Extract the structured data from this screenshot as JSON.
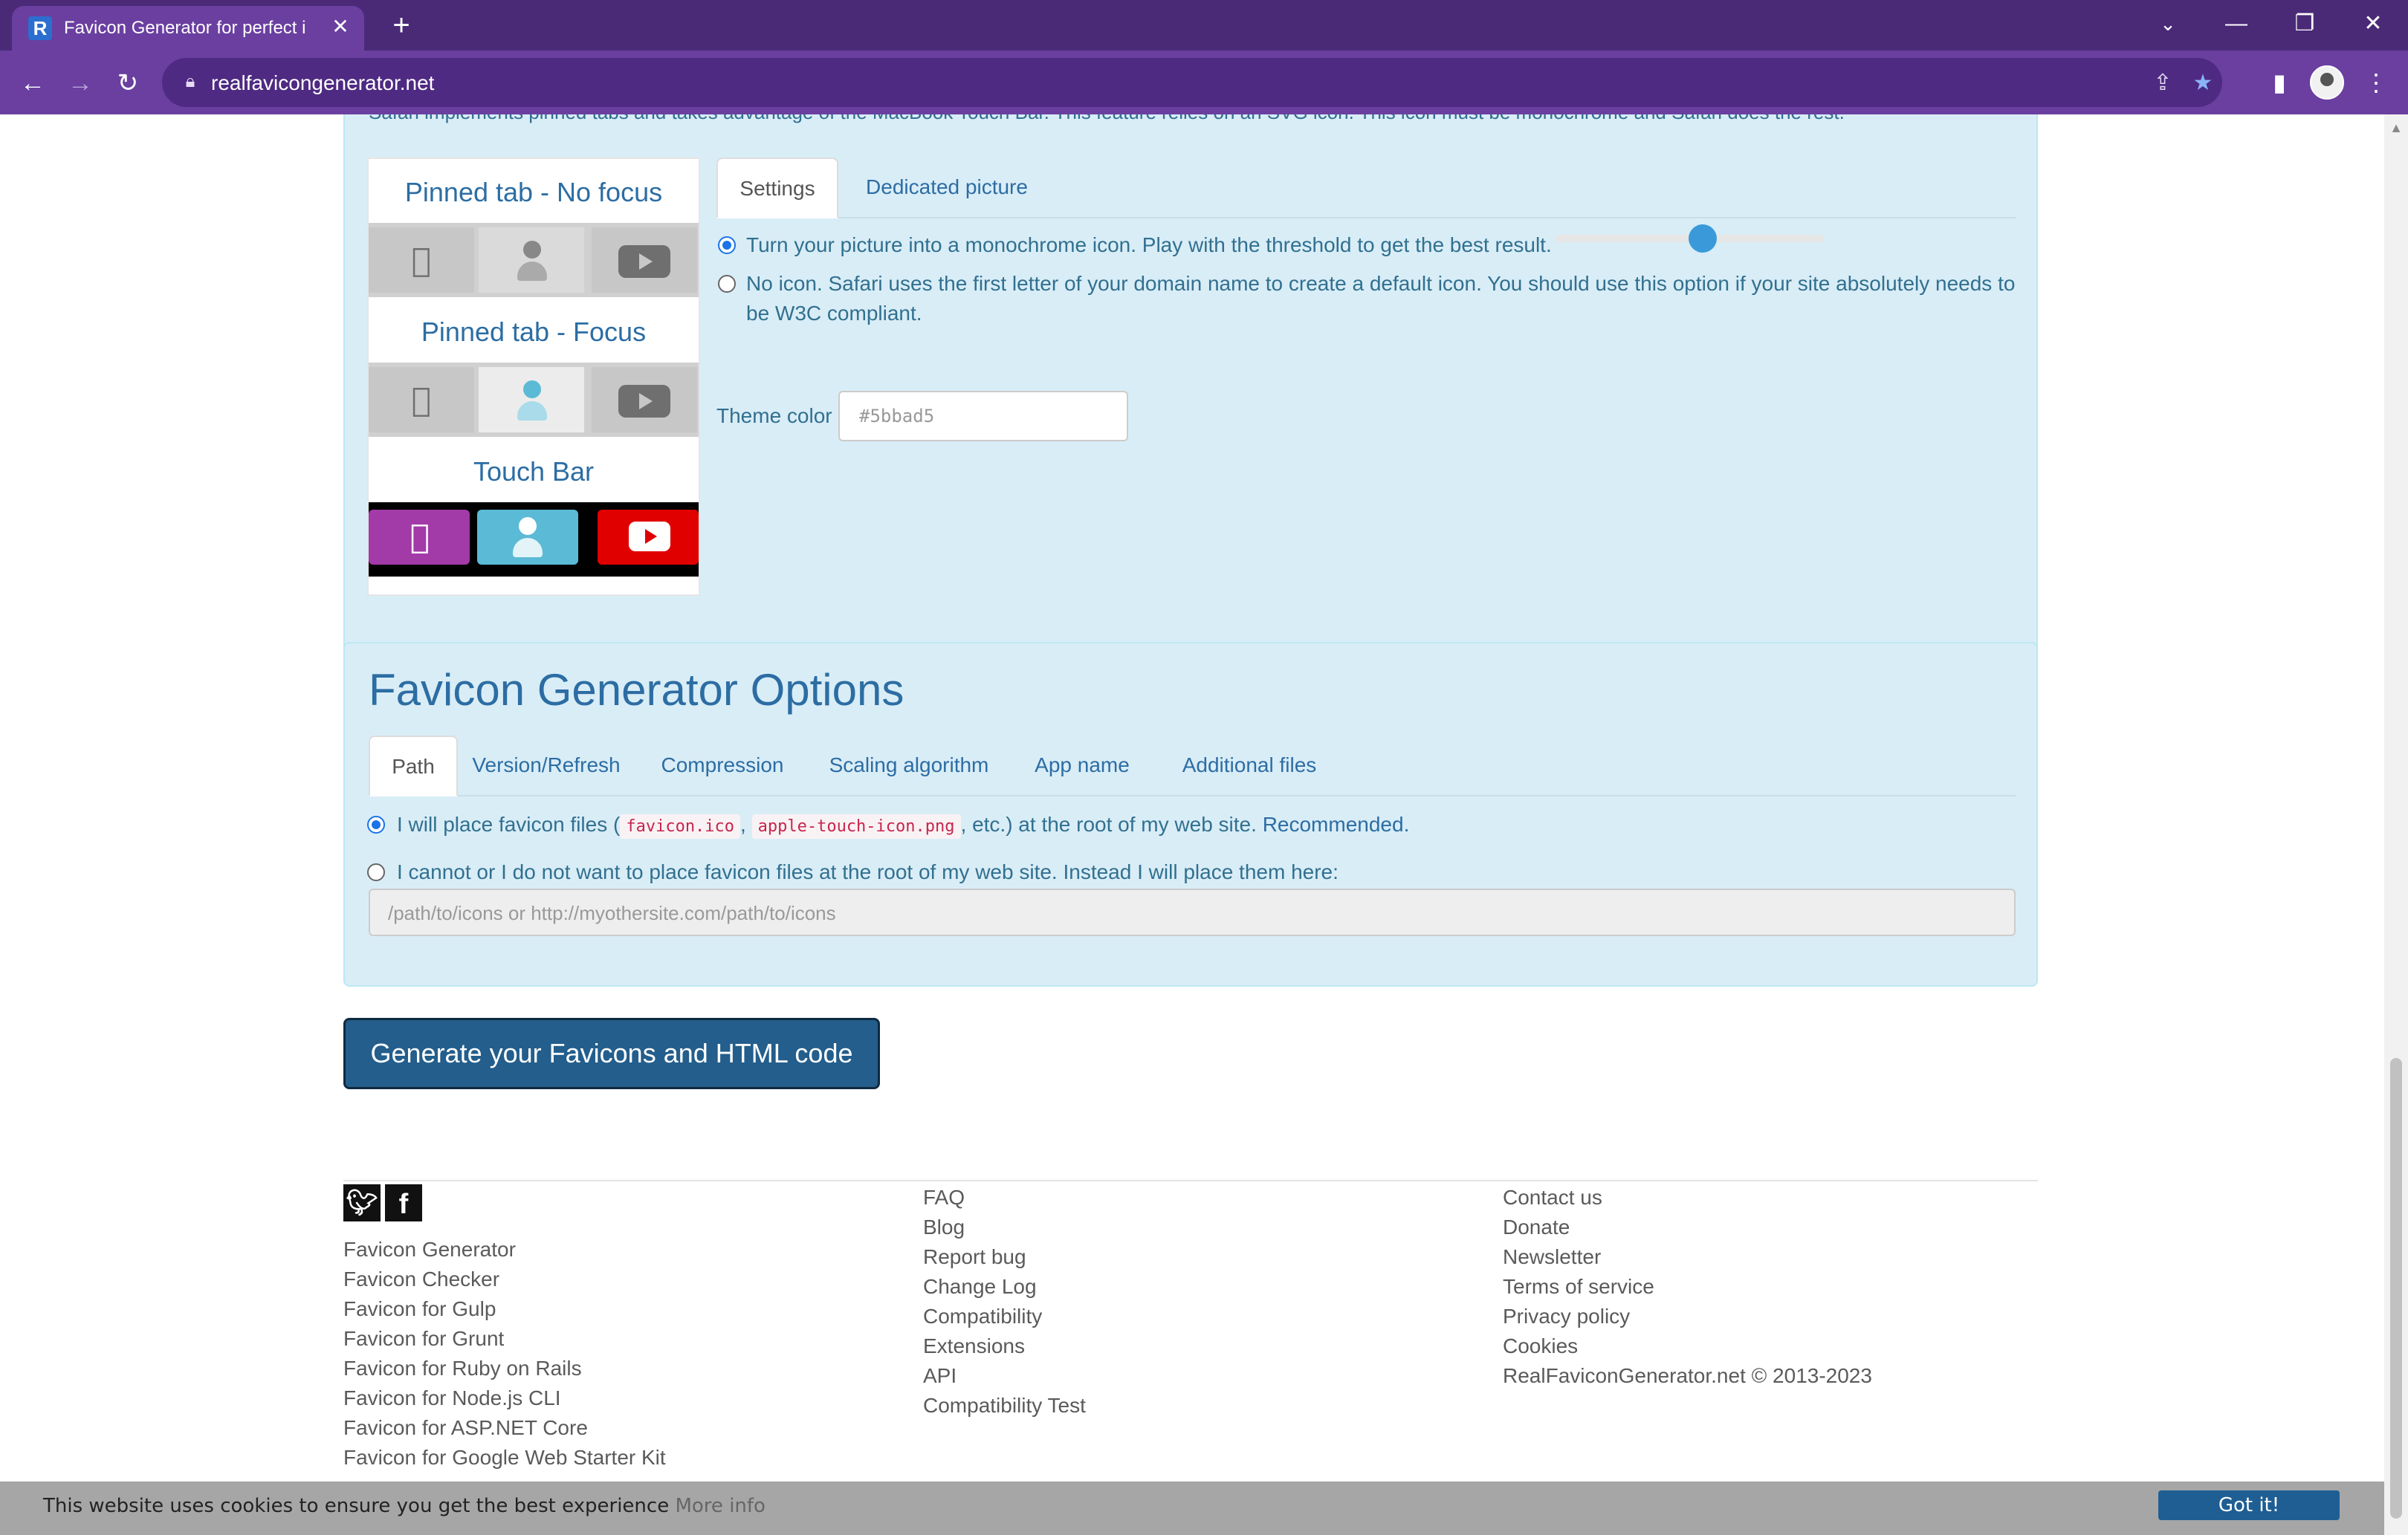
{
  "browser": {
    "tab_title": "Favicon Generator for perfect i",
    "url": "realfavicongenerator.net",
    "new_tab": "+",
    "minimize": "—",
    "restore": "❐",
    "close": "✕"
  },
  "safari": {
    "cut_text": "Safari implements pinned tabs and takes advantage of the MacBook Touch Bar. This feature relies on an SVG icon. This icon must be monochrome and Safari does the rest.",
    "preview": {
      "no_focus": "Pinned tab - No focus",
      "focus": "Pinned tab - Focus",
      "touch_bar": "Touch Bar"
    },
    "tabs": [
      "Settings",
      "Dedicated picture"
    ],
    "option_mono": "Turn your picture into a monochrome icon. Play with the threshold to get the best result.",
    "option_none": "No icon. Safari uses the first letter of your domain name to create a default icon. You should use this option if your site absolutely needs to be W3C compliant.",
    "threshold": 0.55,
    "theme_label": "Theme color",
    "theme_value": "#5bbad5",
    "accent": "#5bbad5"
  },
  "options": {
    "title": "Favicon Generator Options",
    "tabs": [
      "Path",
      "Version/Refresh",
      "Compression",
      "Scaling algorithm",
      "App name",
      "Additional files"
    ],
    "root_prefix": "I will place favicon files (",
    "code1": "favicon.ico",
    "sep": ",",
    "code2": "apple-touch-icon.png",
    "root_suffix": ", etc.) at the root of my web site.",
    "recommended": "Recommended.",
    "other_option": "I cannot or I do not want to place favicon files at the root of my web site. Instead I will place them here:",
    "path_placeholder": "/path/to/icons or http://myothersite.com/path/to/icons"
  },
  "generate_button": "Generate your Favicons and HTML code",
  "footer": {
    "col1": [
      "Favicon Generator",
      "Favicon Checker",
      "Favicon for Gulp",
      "Favicon for Grunt",
      "Favicon for Ruby on Rails",
      "Favicon for Node.js CLI",
      "Favicon for ASP.NET Core",
      "Favicon for Google Web Starter Kit"
    ],
    "col2": [
      "FAQ",
      "Blog",
      "Report bug",
      "Change Log",
      "Compatibility",
      "Extensions",
      "API",
      "Compatibility Test"
    ],
    "col3": [
      "Contact us",
      "Donate",
      "Newsletter",
      "Terms of service",
      "Privacy policy",
      "Cookies",
      "RealFaviconGenerator.net © 2013-2023"
    ]
  },
  "cookie": {
    "text": "This website uses cookies to ensure you get the best experience",
    "more": "More info",
    "button": "Got it!"
  },
  "colors": {
    "chrome": "#6a3fa0",
    "panel": "#d9edf7",
    "button": "#235e8c"
  }
}
